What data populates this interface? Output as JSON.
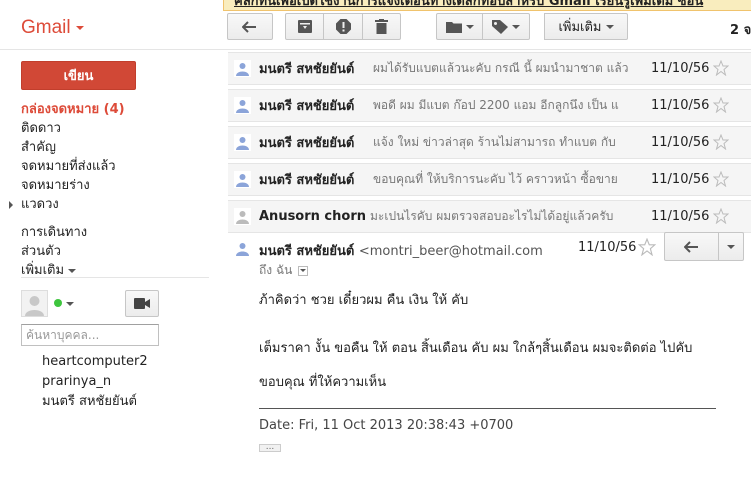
{
  "banner": {
    "text": "คลิกที่นี่เพื่อเปิดใช้งานการแจ้งเตือนทางเดสก์ท็อปสำหรับ Gmail   เรียนรู้เพิ่มเติม   ซ่อน"
  },
  "app": {
    "logo": "Gmail"
  },
  "toolbar": {
    "more_label": "เพิ่มเติม",
    "page_info": "2 จ"
  },
  "compose_label": "เขียน",
  "nav": {
    "inbox": "กล่องจดหมาย (4)",
    "starred": "ติดดาว",
    "important": "สำคัญ",
    "sent": "จดหมายที่ส่งแล้ว",
    "drafts": "จดหมายร่าง",
    "circles": "แวดวง",
    "travel": "การเดินทาง",
    "personal": "ส่วนตัว",
    "more": "เพิ่มเติม"
  },
  "chat": {
    "search_placeholder": "ค้นหาบุคคล...",
    "contacts": [
      "heartcomputer2",
      "prarinya_n",
      "มนตรี สหชัยยันต์"
    ]
  },
  "messages": [
    {
      "sender": "มนตรี สหชัยยันต์",
      "snippet": "ผมได้รับแบตแล้วนะคับ กรณี นี้ ผมนำมาชาต แล้ว",
      "date": "11/10/56"
    },
    {
      "sender": "มนตรี สหชัยยันต์",
      "snippet": "พอดี ผม มีแบต ก๊อป 2200 แอม อีกลูกนึง เป็น แ",
      "date": "11/10/56"
    },
    {
      "sender": "มนตรี สหชัยยันต์",
      "snippet": "แจ้ง ใหม่ ข่าวล่าสุด ร้านไม่สามารถ ทำแบต กับ",
      "date": "11/10/56"
    },
    {
      "sender": "มนตรี สหชัยยันต์",
      "snippet": "ขอบคุณที่ ให้บริการนะคับ ไว้ คราวหน้า ซื้อขาย",
      "date": "11/10/56"
    },
    {
      "sender": "Anusorn chorn",
      "snippet": "มะเปนไรคับ ผมตรวจสอบอะไรไม่ได้อยู่แล้วครับ",
      "date": "11/10/56"
    }
  ],
  "open_message": {
    "sender": "มนตรี สหชัยยันต์",
    "email": "<montri_beer@hotmail.com",
    "date": "11/10/56",
    "to": "ถึง ฉัน",
    "body1": "ภ้าคิดว่า ชวย เดี๋ยวผม คืน เงิน ให้ คับ",
    "body2": "เต็มราคา  งั้น ขอคืน ให้ ตอน สิ้นเดือน คับ ผม ใกล้ๆสิ้นเดือน ผมจะติดต่อ ไปคับ",
    "body3": "ขอบคุณ ที่ให้ความเห็น",
    "date_line": "Date: Fri, 11 Oct 2013 20:38:43 +0700",
    "ellipsis": "..."
  }
}
